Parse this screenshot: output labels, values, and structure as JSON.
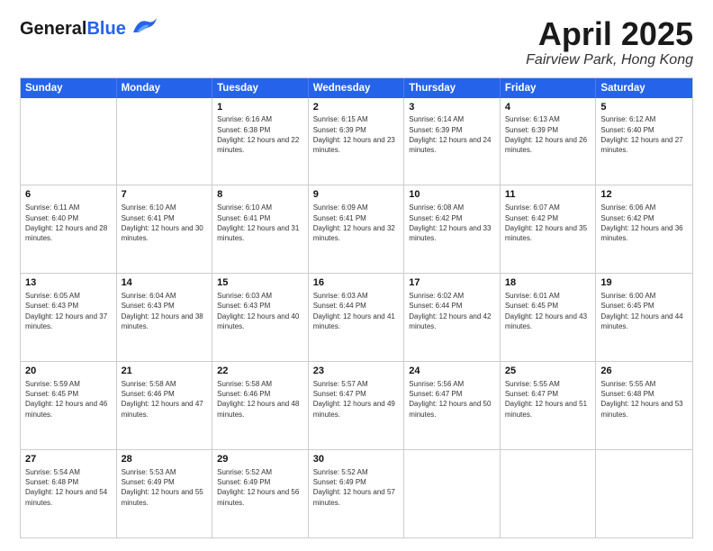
{
  "header": {
    "logo": {
      "general": "General",
      "blue": "Blue"
    },
    "title": "April 2025",
    "subtitle": "Fairview Park, Hong Kong"
  },
  "calendar": {
    "days": [
      "Sunday",
      "Monday",
      "Tuesday",
      "Wednesday",
      "Thursday",
      "Friday",
      "Saturday"
    ],
    "rows": [
      [
        {
          "day": "",
          "sunrise": "",
          "sunset": "",
          "daylight": ""
        },
        {
          "day": "",
          "sunrise": "",
          "sunset": "",
          "daylight": ""
        },
        {
          "day": "1",
          "sunrise": "Sunrise: 6:16 AM",
          "sunset": "Sunset: 6:38 PM",
          "daylight": "Daylight: 12 hours and 22 minutes."
        },
        {
          "day": "2",
          "sunrise": "Sunrise: 6:15 AM",
          "sunset": "Sunset: 6:39 PM",
          "daylight": "Daylight: 12 hours and 23 minutes."
        },
        {
          "day": "3",
          "sunrise": "Sunrise: 6:14 AM",
          "sunset": "Sunset: 6:39 PM",
          "daylight": "Daylight: 12 hours and 24 minutes."
        },
        {
          "day": "4",
          "sunrise": "Sunrise: 6:13 AM",
          "sunset": "Sunset: 6:39 PM",
          "daylight": "Daylight: 12 hours and 26 minutes."
        },
        {
          "day": "5",
          "sunrise": "Sunrise: 6:12 AM",
          "sunset": "Sunset: 6:40 PM",
          "daylight": "Daylight: 12 hours and 27 minutes."
        }
      ],
      [
        {
          "day": "6",
          "sunrise": "Sunrise: 6:11 AM",
          "sunset": "Sunset: 6:40 PM",
          "daylight": "Daylight: 12 hours and 28 minutes."
        },
        {
          "day": "7",
          "sunrise": "Sunrise: 6:10 AM",
          "sunset": "Sunset: 6:41 PM",
          "daylight": "Daylight: 12 hours and 30 minutes."
        },
        {
          "day": "8",
          "sunrise": "Sunrise: 6:10 AM",
          "sunset": "Sunset: 6:41 PM",
          "daylight": "Daylight: 12 hours and 31 minutes."
        },
        {
          "day": "9",
          "sunrise": "Sunrise: 6:09 AM",
          "sunset": "Sunset: 6:41 PM",
          "daylight": "Daylight: 12 hours and 32 minutes."
        },
        {
          "day": "10",
          "sunrise": "Sunrise: 6:08 AM",
          "sunset": "Sunset: 6:42 PM",
          "daylight": "Daylight: 12 hours and 33 minutes."
        },
        {
          "day": "11",
          "sunrise": "Sunrise: 6:07 AM",
          "sunset": "Sunset: 6:42 PM",
          "daylight": "Daylight: 12 hours and 35 minutes."
        },
        {
          "day": "12",
          "sunrise": "Sunrise: 6:06 AM",
          "sunset": "Sunset: 6:42 PM",
          "daylight": "Daylight: 12 hours and 36 minutes."
        }
      ],
      [
        {
          "day": "13",
          "sunrise": "Sunrise: 6:05 AM",
          "sunset": "Sunset: 6:43 PM",
          "daylight": "Daylight: 12 hours and 37 minutes."
        },
        {
          "day": "14",
          "sunrise": "Sunrise: 6:04 AM",
          "sunset": "Sunset: 6:43 PM",
          "daylight": "Daylight: 12 hours and 38 minutes."
        },
        {
          "day": "15",
          "sunrise": "Sunrise: 6:03 AM",
          "sunset": "Sunset: 6:43 PM",
          "daylight": "Daylight: 12 hours and 40 minutes."
        },
        {
          "day": "16",
          "sunrise": "Sunrise: 6:03 AM",
          "sunset": "Sunset: 6:44 PM",
          "daylight": "Daylight: 12 hours and 41 minutes."
        },
        {
          "day": "17",
          "sunrise": "Sunrise: 6:02 AM",
          "sunset": "Sunset: 6:44 PM",
          "daylight": "Daylight: 12 hours and 42 minutes."
        },
        {
          "day": "18",
          "sunrise": "Sunrise: 6:01 AM",
          "sunset": "Sunset: 6:45 PM",
          "daylight": "Daylight: 12 hours and 43 minutes."
        },
        {
          "day": "19",
          "sunrise": "Sunrise: 6:00 AM",
          "sunset": "Sunset: 6:45 PM",
          "daylight": "Daylight: 12 hours and 44 minutes."
        }
      ],
      [
        {
          "day": "20",
          "sunrise": "Sunrise: 5:59 AM",
          "sunset": "Sunset: 6:45 PM",
          "daylight": "Daylight: 12 hours and 46 minutes."
        },
        {
          "day": "21",
          "sunrise": "Sunrise: 5:58 AM",
          "sunset": "Sunset: 6:46 PM",
          "daylight": "Daylight: 12 hours and 47 minutes."
        },
        {
          "day": "22",
          "sunrise": "Sunrise: 5:58 AM",
          "sunset": "Sunset: 6:46 PM",
          "daylight": "Daylight: 12 hours and 48 minutes."
        },
        {
          "day": "23",
          "sunrise": "Sunrise: 5:57 AM",
          "sunset": "Sunset: 6:47 PM",
          "daylight": "Daylight: 12 hours and 49 minutes."
        },
        {
          "day": "24",
          "sunrise": "Sunrise: 5:56 AM",
          "sunset": "Sunset: 6:47 PM",
          "daylight": "Daylight: 12 hours and 50 minutes."
        },
        {
          "day": "25",
          "sunrise": "Sunrise: 5:55 AM",
          "sunset": "Sunset: 6:47 PM",
          "daylight": "Daylight: 12 hours and 51 minutes."
        },
        {
          "day": "26",
          "sunrise": "Sunrise: 5:55 AM",
          "sunset": "Sunset: 6:48 PM",
          "daylight": "Daylight: 12 hours and 53 minutes."
        }
      ],
      [
        {
          "day": "27",
          "sunrise": "Sunrise: 5:54 AM",
          "sunset": "Sunset: 6:48 PM",
          "daylight": "Daylight: 12 hours and 54 minutes."
        },
        {
          "day": "28",
          "sunrise": "Sunrise: 5:53 AM",
          "sunset": "Sunset: 6:49 PM",
          "daylight": "Daylight: 12 hours and 55 minutes."
        },
        {
          "day": "29",
          "sunrise": "Sunrise: 5:52 AM",
          "sunset": "Sunset: 6:49 PM",
          "daylight": "Daylight: 12 hours and 56 minutes."
        },
        {
          "day": "30",
          "sunrise": "Sunrise: 5:52 AM",
          "sunset": "Sunset: 6:49 PM",
          "daylight": "Daylight: 12 hours and 57 minutes."
        },
        {
          "day": "",
          "sunrise": "",
          "sunset": "",
          "daylight": ""
        },
        {
          "day": "",
          "sunrise": "",
          "sunset": "",
          "daylight": ""
        },
        {
          "day": "",
          "sunrise": "",
          "sunset": "",
          "daylight": ""
        }
      ]
    ]
  }
}
